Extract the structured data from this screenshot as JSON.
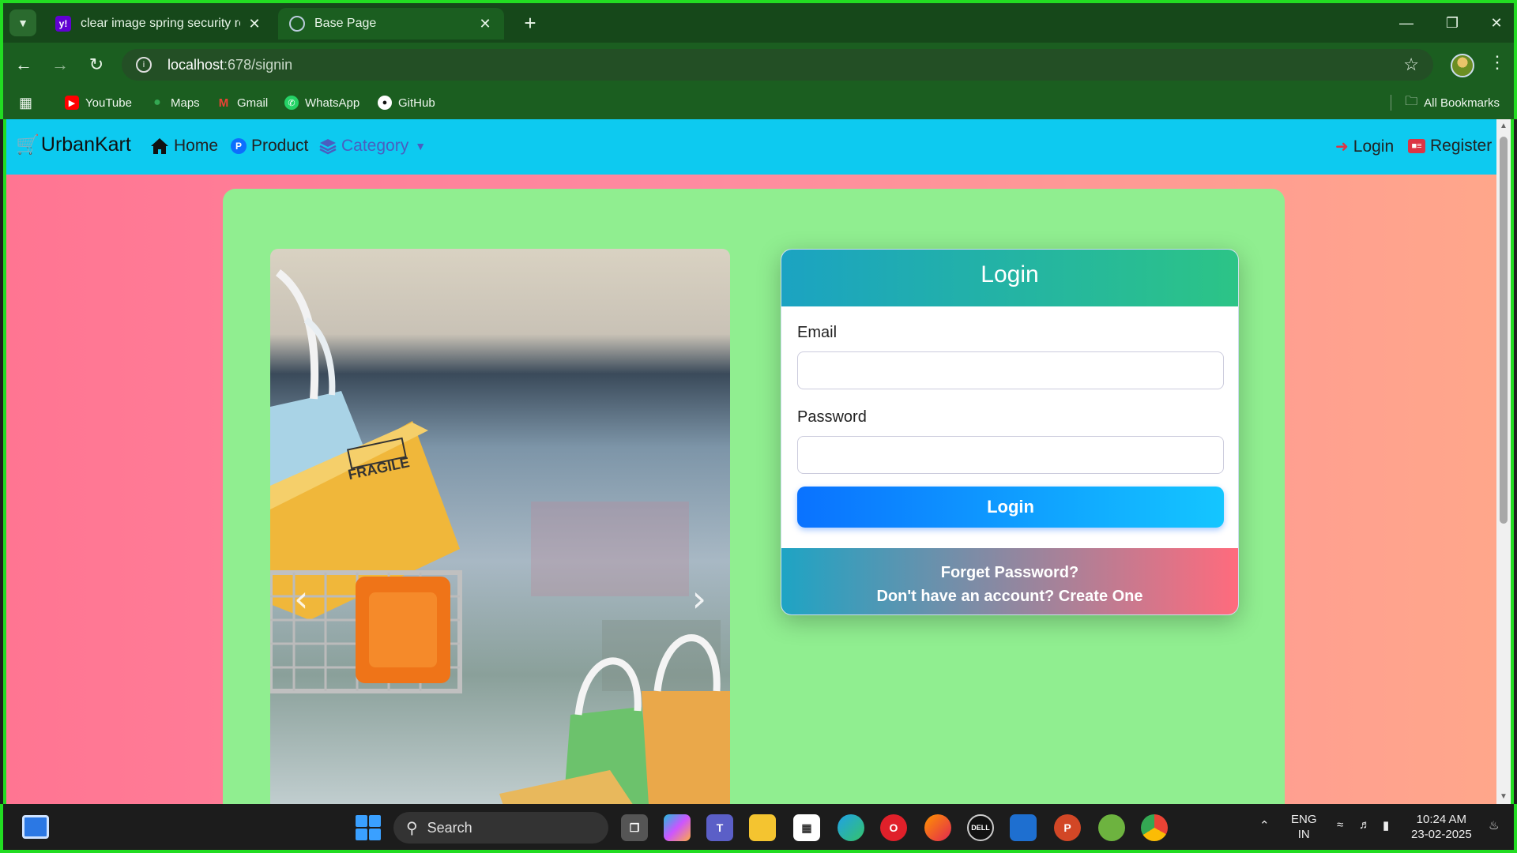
{
  "browser": {
    "tabs": [
      {
        "title": "clear image spring security regi",
        "favicon": "yahoo-favicon"
      },
      {
        "title": "Base Page",
        "favicon": "globe-favicon"
      }
    ],
    "url_host": "localhost",
    "url_path": ":678/signin",
    "bookmarks": [
      {
        "label": "YouTube",
        "icon": "youtube-icon"
      },
      {
        "label": "Maps",
        "icon": "maps-icon"
      },
      {
        "label": "Gmail",
        "icon": "gmail-icon"
      },
      {
        "label": "WhatsApp",
        "icon": "whatsapp-icon"
      },
      {
        "label": "GitHub",
        "icon": "github-icon"
      }
    ],
    "all_bookmarks": "All Bookmarks"
  },
  "navbar": {
    "brand": "UrbanKart",
    "home": "Home",
    "product": "Product",
    "category": "Category",
    "login": "Login",
    "register": "Register",
    "color": "#0dcaf0"
  },
  "login_card": {
    "title": "Login",
    "email_label": "Email",
    "email_value": "",
    "password_label": "Password",
    "password_value": "",
    "submit_label": "Login",
    "forgot": "Forget Password?",
    "signup_prompt": "Don't have an account? Create One"
  },
  "carousel": {
    "box_label": "FRAGILE"
  },
  "taskbar": {
    "search_label": "Search",
    "lang_1": "ENG",
    "lang_2": "IN",
    "time": "10:24 AM",
    "date": "23-02-2025"
  },
  "colors": {
    "container": "#90ee90",
    "background_left": "#ff7592",
    "background_right": "#ffa78a"
  }
}
